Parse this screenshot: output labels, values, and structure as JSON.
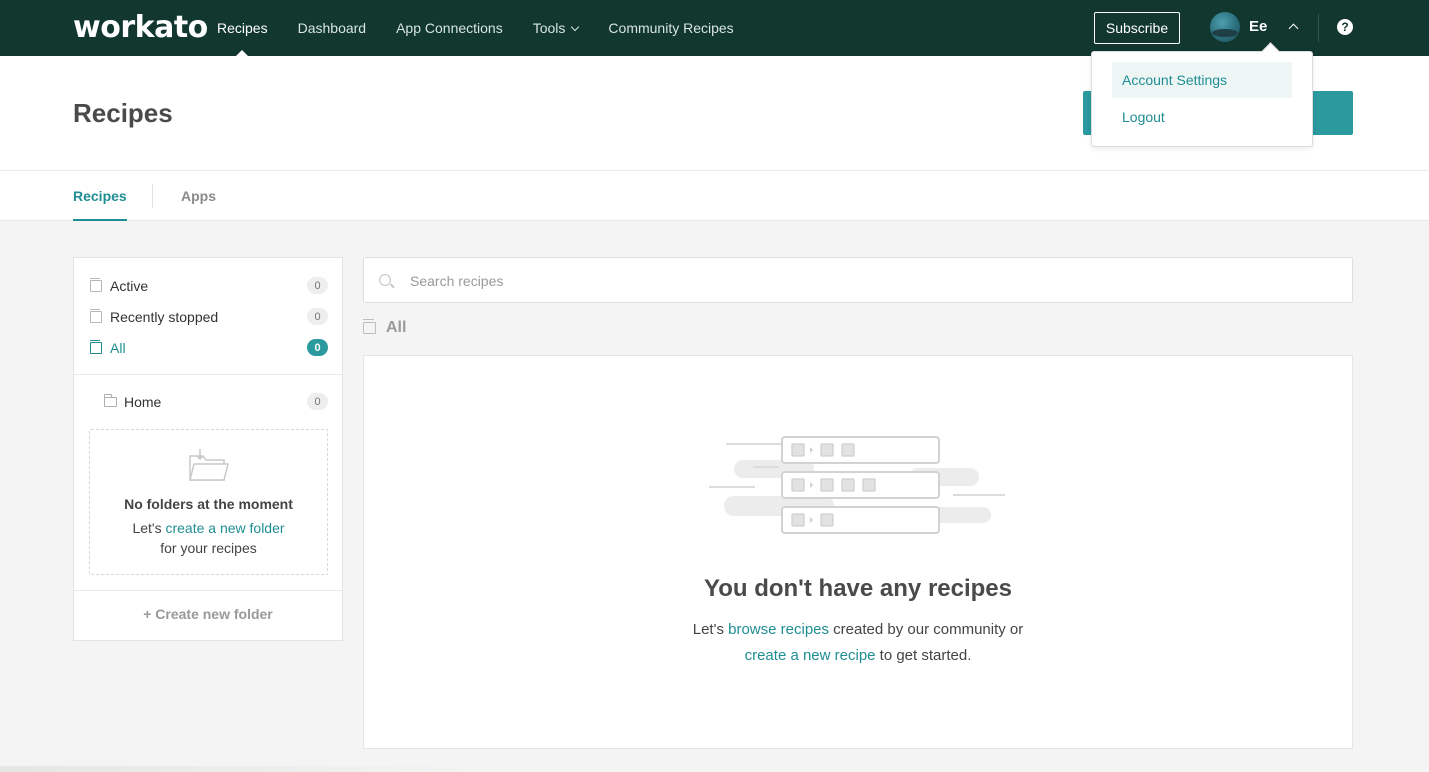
{
  "brand": {
    "logo_text": "workato"
  },
  "nav": {
    "items": [
      {
        "label": "Recipes",
        "active": true
      },
      {
        "label": "Dashboard"
      },
      {
        "label": "App Connections"
      },
      {
        "label": "Tools",
        "has_dropdown": true
      },
      {
        "label": "Community Recipes"
      }
    ],
    "subscribe_label": "Subscribe",
    "user_name": "Ee",
    "help_glyph": "?"
  },
  "user_menu": {
    "items": [
      {
        "label": "Account Settings"
      },
      {
        "label": "Logout"
      }
    ]
  },
  "header": {
    "title": "Recipes"
  },
  "tabs": [
    {
      "label": "Recipes",
      "active": true
    },
    {
      "label": "Apps"
    }
  ],
  "sidebar": {
    "filters": [
      {
        "label": "Active",
        "count": "0"
      },
      {
        "label": "Recently stopped",
        "count": "0"
      },
      {
        "label": "All",
        "count": "0",
        "selected": true
      }
    ],
    "home": {
      "label": "Home",
      "count": "0"
    },
    "empty_folders": {
      "title": "No folders at the moment",
      "line1_prefix": "Let's ",
      "line1_link": "create a new folder",
      "line2": "for your recipes"
    },
    "create_folder_label": "+ Create new folder"
  },
  "search": {
    "placeholder": "Search recipes",
    "value": ""
  },
  "list_title": "All",
  "empty_state": {
    "title": "You don't have any recipes",
    "line1_prefix": "Let's ",
    "line1_link": "browse recipes",
    "line1_suffix": " created by our community or",
    "line2_link": "create a new recipe",
    "line2_suffix": " to get started."
  },
  "colors": {
    "nav_bg": "#11372f",
    "accent": "#2a9a9f",
    "link": "#1f8e93"
  }
}
